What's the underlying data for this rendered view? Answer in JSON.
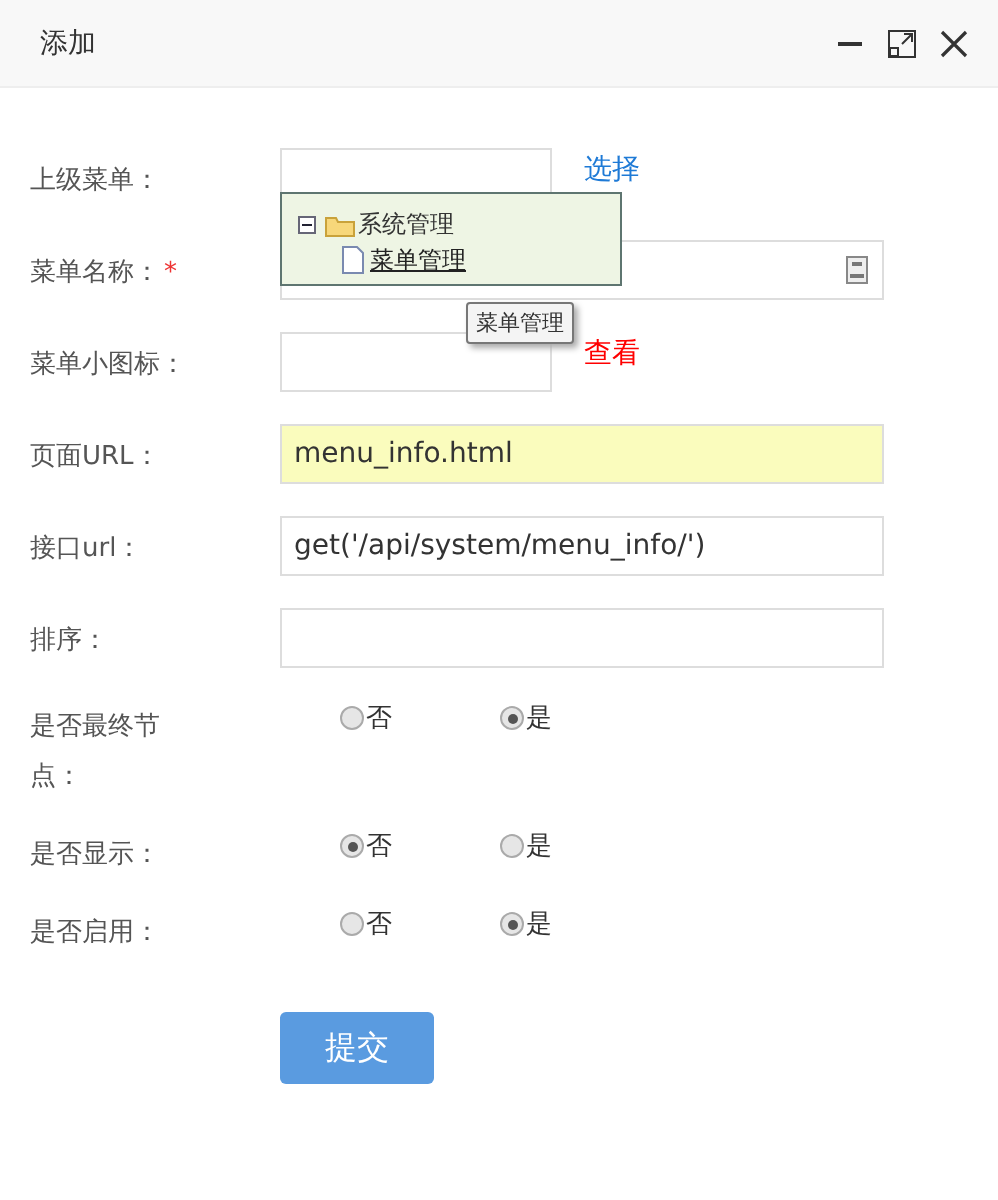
{
  "window": {
    "title": "添加"
  },
  "fields": [
    {
      "kind": "picker",
      "label": "上级菜单：",
      "link": {
        "text": "选择",
        "color": "#1e7ad6"
      },
      "tree": [
        {
          "label": "系统管理",
          "expanded": true,
          "children": [
            {
              "label": "菜单管理"
            }
          ]
        }
      ],
      "tooltip": "菜单管理"
    },
    {
      "kind": "text",
      "label": "菜单名称：",
      "required_mark": "*",
      "highlighted": false,
      "icon": true
    },
    {
      "kind": "picker",
      "label": "菜单小图标：",
      "link": {
        "text": "查看",
        "color": "#ff0000"
      }
    },
    {
      "kind": "text",
      "label": "页面URL：",
      "value": "menu_info.html",
      "highlighted": true
    },
    {
      "kind": "text",
      "label": "接口url：",
      "value": "get('/api/system/menu_info/')",
      "highlighted": false
    },
    {
      "kind": "text",
      "label": "排序：",
      "highlighted": false
    },
    {
      "kind": "radio",
      "label": "是否最终节点：",
      "options": [
        {
          "label": "否",
          "selected": false
        },
        {
          "label": "是",
          "selected": true
        }
      ]
    },
    {
      "kind": "radio",
      "label": "是否显示：",
      "options": [
        {
          "label": "否",
          "selected": true
        },
        {
          "label": "是",
          "selected": false
        }
      ]
    },
    {
      "kind": "radio",
      "label": "是否启用：",
      "options": [
        {
          "label": "否",
          "selected": false
        },
        {
          "label": "是",
          "selected": true
        }
      ]
    }
  ],
  "submit": "提交"
}
